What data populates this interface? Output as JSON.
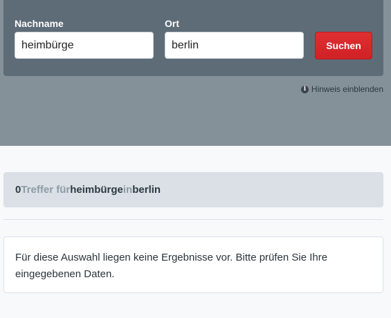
{
  "search": {
    "surname_label": "Nachname",
    "surname_value": "heimbürge",
    "city_label": "Ort",
    "city_value": "berlin",
    "submit_label": "Suchen",
    "hint_toggle_label": "Hinweis einblenden",
    "hint_icon": "info-icon"
  },
  "result": {
    "count": "0",
    "hits_word": "Treffer für",
    "query_name": "heimbürge",
    "in_word": "in",
    "query_city": "berlin"
  },
  "message": {
    "text": "Für diese Auswahl liegen keine Ergebnisse vor. Bitte prüfen Sie Ihre eingegebenen Daten."
  },
  "colors": {
    "hero_bg": "#859199",
    "panel_bg": "#5e6c78",
    "button_red": "#d7262a",
    "result_bg": "#dae0e6",
    "muted_text": "#8d9ba5"
  }
}
